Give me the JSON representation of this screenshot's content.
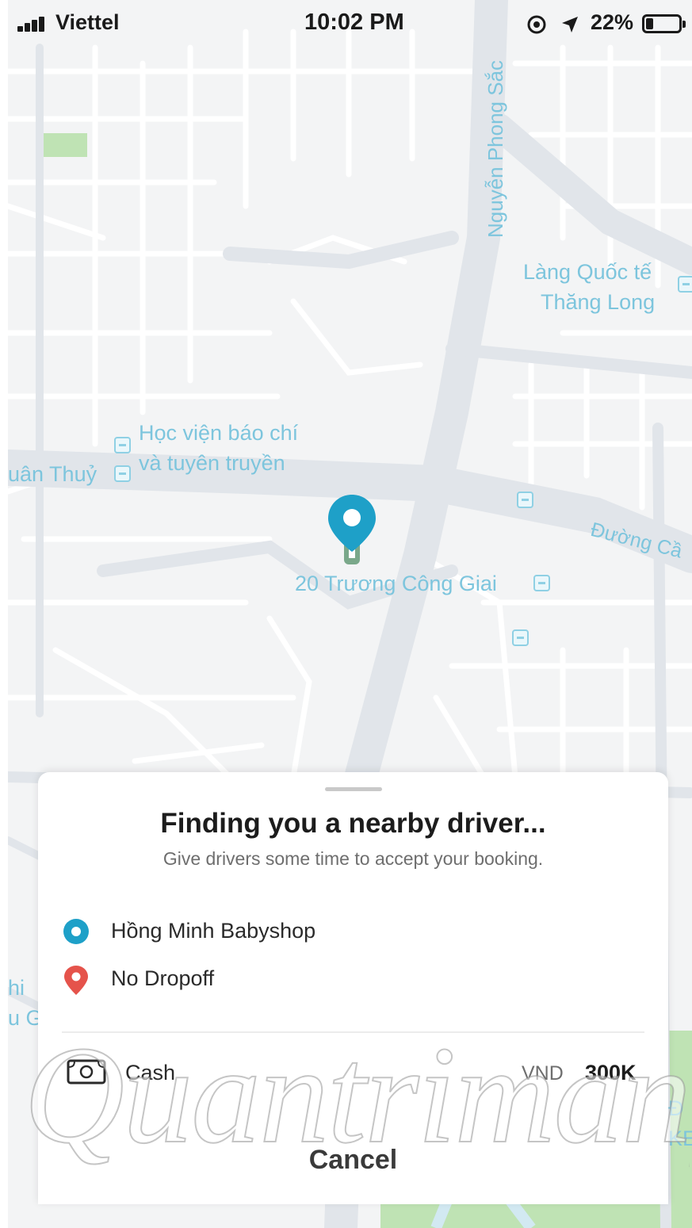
{
  "status_bar": {
    "carrier": "Viettel",
    "time": "10:02 PM",
    "battery_percent": "22%",
    "battery_level": 0.22,
    "signal_bars": 3
  },
  "map": {
    "labels": {
      "street_nguyen_phong_sac": "Nguyễn Phong Sắc",
      "lang_quoc_te_line1": "Làng Quốc tế",
      "lang_quoc_te_line2": "Thăng Long",
      "hoc_vien_line1": "Học viện báo chí",
      "hoc_vien_line2": "và tuyên truyền",
      "xuan_thuy_partial": "uân Thuỷ",
      "duong_partial": "Đường Cầ",
      "pickup_address": "20 Trương Công Giai",
      "edge_left_1": "hi",
      "edge_left_2": "u G",
      "edge_right_1": "Đ",
      "edge_right_2": "KE"
    },
    "colors": {
      "background": "#f3f4f5",
      "road": "#e1e5ea",
      "label": "#7dc5dd",
      "park": "#bfe3b4"
    }
  },
  "booking": {
    "title": "Finding you a nearby driver...",
    "subtitle": "Give drivers some time to accept your booking.",
    "pickup": "Hồng Minh Babyshop",
    "dropoff": "No Dropoff",
    "payment_method": "Cash",
    "currency": "VND",
    "fare": "300K",
    "cancel_label": "Cancel",
    "icons": {
      "pickup": "pickup-dot-icon",
      "dropoff": "dropoff-pin-icon",
      "payment": "cash-icon"
    },
    "colors": {
      "pickup": "#1ea0c8",
      "dropoff": "#e5534b"
    }
  },
  "watermark": {
    "text": "Quantrimang"
  }
}
